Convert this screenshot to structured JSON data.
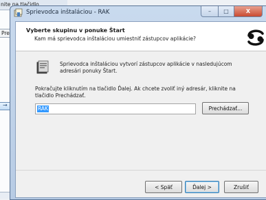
{
  "background_window": {
    "top_text": "nite na tlačidlo",
    "side_button": "Prec",
    "arrow_glyph": "→"
  },
  "dialog": {
    "title": "Sprievodca inštaláciou - RAK",
    "header": {
      "heading": "Vyberte skupinu v ponuke Štart",
      "subheading": "Kam má sprievodca inštaláciou umiestniť zástupcov aplikácie?"
    },
    "info_text": "Sprievodca inštaláciou vytvorí zástupcov aplikácie v nasledujúcom adresári ponuky Štart.",
    "instruction_text": "Pokračujte kliknutím na tlačidlo Ďalej. Ak chcete zvoliť iný adresár, kliknite na tlačidlo Prechádzať.",
    "folder_value": "RAK",
    "browse_label": "Prechádzať...",
    "back_label": "< Späť",
    "next_label": "Ďalej >",
    "cancel_label": "Zrušiť"
  },
  "colors": {
    "accent": "#3399ff",
    "title_bar": "#c9daee",
    "close_button": "#c84a31"
  }
}
